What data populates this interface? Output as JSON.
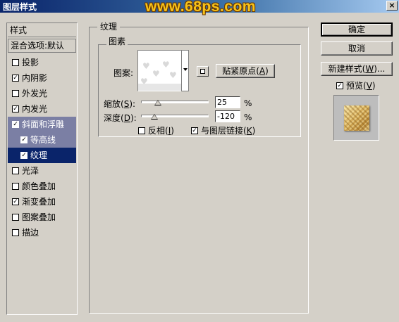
{
  "window": {
    "title": "图层样式",
    "watermark": "www.68ps.com",
    "close_label": "×"
  },
  "styles_panel": {
    "header": "样式",
    "blending_options": "混合选项:默认",
    "items": [
      {
        "label": "投影",
        "checked": false
      },
      {
        "label": "内阴影",
        "checked": true
      },
      {
        "label": "外发光",
        "checked": false
      },
      {
        "label": "内发光",
        "checked": true
      },
      {
        "label": "斜面和浮雕",
        "checked": true,
        "selected": "light"
      },
      {
        "label": "等高线",
        "checked": true,
        "sub": true,
        "selected": "light"
      },
      {
        "label": "纹理",
        "checked": true,
        "sub": true,
        "selected": "dark"
      },
      {
        "label": "光泽",
        "checked": false
      },
      {
        "label": "颜色叠加",
        "checked": false
      },
      {
        "label": "渐变叠加",
        "checked": true
      },
      {
        "label": "图案叠加",
        "checked": false
      },
      {
        "label": "描边",
        "checked": false
      }
    ]
  },
  "texture": {
    "group_title": "纹理",
    "pattern_group_title": "图素",
    "pattern_label": "图案:",
    "snap_button": "贴紧原点",
    "snap_key": "A",
    "scale_label": "缩放",
    "scale_key": "S",
    "scale_value": "25",
    "scale_fraction": 0.25,
    "depth_label": "深度",
    "depth_key": "D",
    "depth_value": "-120",
    "depth_fraction": 0.2,
    "percent": "%",
    "invert_label": "反相",
    "invert_key": "I",
    "invert_checked": false,
    "link_label": "与图层链接",
    "link_key": "K",
    "link_checked": true
  },
  "buttons": {
    "ok": "确定",
    "cancel": "取消",
    "new_style": "新建样式",
    "new_style_key": "W",
    "preview_label": "预览",
    "preview_key": "V",
    "preview_checked": true
  },
  "colors": {
    "selected_dark": "#0a246a",
    "selected_light": "#7b7fa4",
    "dialog_bg": "#d4d0c8",
    "watermark": "#f7c21a"
  }
}
